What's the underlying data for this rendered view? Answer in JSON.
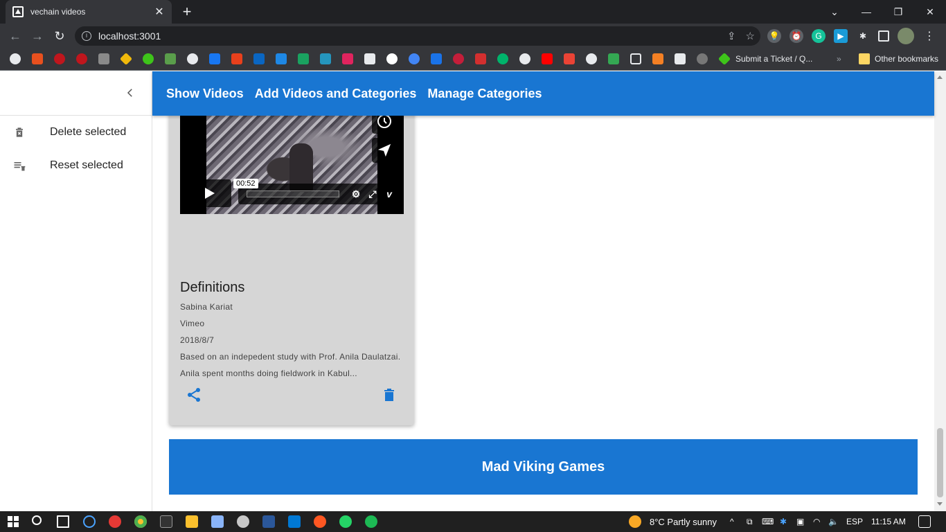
{
  "browser": {
    "tab_title": "vechain videos",
    "url": "localhost:3001",
    "bookmark_ticket": "Submit a Ticket / Q...",
    "bookmark_other": "Other bookmarks",
    "more_bookmarks": "»"
  },
  "sidebar": {
    "items": [
      {
        "label": "Delete selected",
        "icon": "delete-sweep-icon"
      },
      {
        "label": "Reset selected",
        "icon": "clear-all-icon"
      }
    ]
  },
  "appbar": {
    "links": [
      "Show Videos",
      "Add Videos and Categories",
      "Manage Categories"
    ]
  },
  "video_card": {
    "player_time": "00:52",
    "title": "Definitions",
    "author": "Sabina Kariat",
    "source": "Vimeo",
    "date": "2018/8/7",
    "description_line1": "Based on an indepedent study with Prof. Anila Daulatzai.",
    "description_line2": "Anila spent months doing fieldwork in Kabul..."
  },
  "footer": {
    "text": "Mad Viking Games"
  },
  "taskbar": {
    "weather": "8°C  Partly sunny",
    "language": "ESP",
    "time": "11:15 AM"
  },
  "colors": {
    "primary": "#1976d2",
    "card": "#d6d6d6",
    "chrome_dark": "#35363a"
  }
}
